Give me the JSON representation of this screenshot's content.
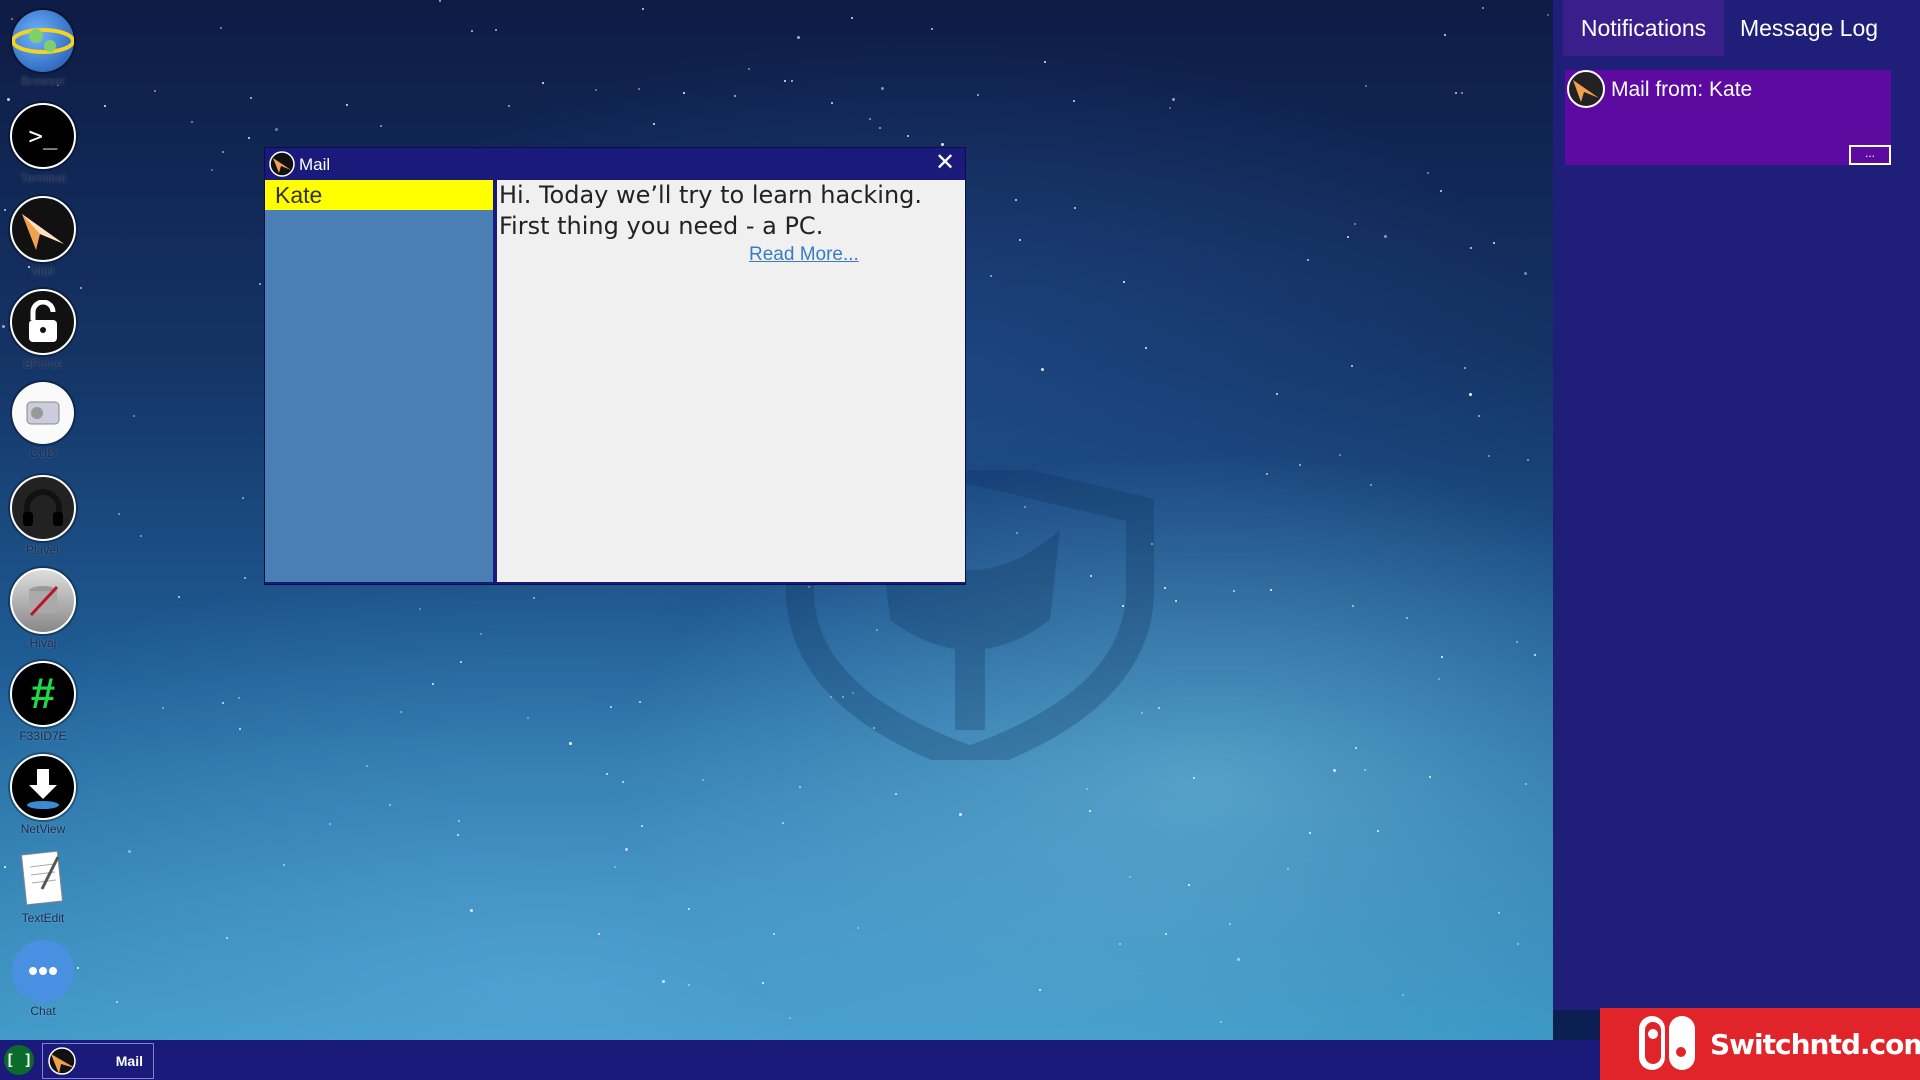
{
  "desktop": {
    "icons": [
      {
        "label": "Browser",
        "icon": "globe-icon"
      },
      {
        "label": "Terminal",
        "icon": "terminal-icon"
      },
      {
        "label": "Mail",
        "icon": "paper-plane-icon"
      },
      {
        "label": "BForce",
        "icon": "unlock-icon"
      },
      {
        "label": "CUD",
        "icon": "drive-icon"
      },
      {
        "label": "Player",
        "icon": "headphones-icon"
      },
      {
        "label": "Hivaj",
        "icon": "database-syringe-icon"
      },
      {
        "label": "F33ID7E",
        "icon": "hash-icon"
      },
      {
        "label": "NetView",
        "icon": "download-globe-icon"
      },
      {
        "label": "TextEdit",
        "icon": "notepad-icon"
      },
      {
        "label": "Chat",
        "icon": "chat-bubble-icon"
      }
    ]
  },
  "mail_window": {
    "title": "Mail",
    "inbox": [
      {
        "sender": "Kate"
      }
    ],
    "message_lines": [
      "Hi. Today we’ll try to learn hacking.",
      "First thing you need - a PC."
    ],
    "read_more": "Read More..."
  },
  "notification_panel": {
    "tabs": [
      {
        "label": "Notifications"
      },
      {
        "label": "Message Log"
      }
    ],
    "notifications": [
      {
        "text": "Mail from: Kate",
        "icon": "paper-plane-icon",
        "more": "..."
      }
    ]
  },
  "taskbar": {
    "items": [
      {
        "label": "Mail",
        "icon": "paper-plane-icon"
      }
    ]
  },
  "watermark": {
    "text": "Switchntd.com"
  },
  "colors": {
    "window_frame": "#1a1a7a",
    "inbox_list": "#4a7fb5",
    "selected_item": "#ffff00",
    "notification_card": "#5c0aa0",
    "brand_red": "#e0242a"
  }
}
